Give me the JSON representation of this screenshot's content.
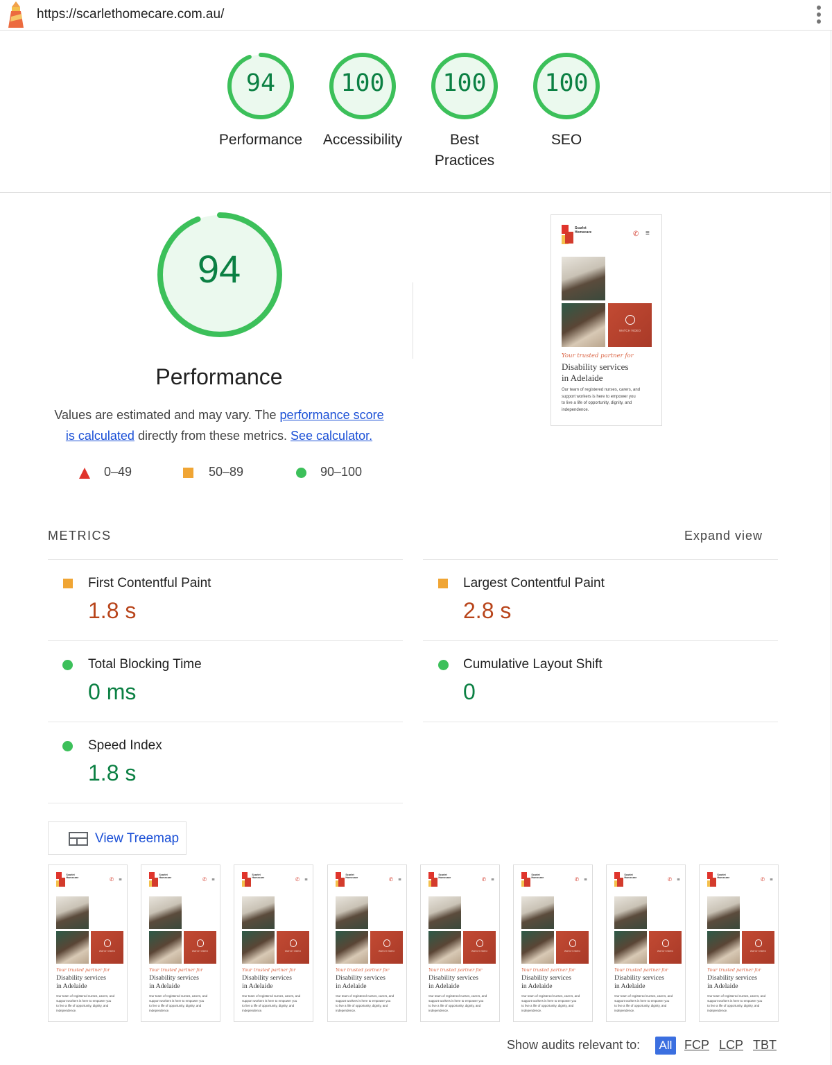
{
  "browser": {
    "url": "https://scarlethomecare.com.au/"
  },
  "colors": {
    "pass": "#3cc05a",
    "pass_text": "#0b8043",
    "average": "#f0a534",
    "average_text": "#b8441a",
    "fail": "#e0342c",
    "link": "#1a4fd6"
  },
  "categories": [
    {
      "score": "94",
      "score_fraction": 0.94,
      "label": "Performance"
    },
    {
      "score": "100",
      "score_fraction": 1.0,
      "label": "Accessibility"
    },
    {
      "score": "100",
      "score_fraction": 1.0,
      "label_line1": "Best",
      "label_line2": "Practices"
    },
    {
      "score": "100",
      "score_fraction": 1.0,
      "label": "SEO"
    }
  ],
  "performance": {
    "score": "94",
    "score_fraction": 0.94,
    "title": "Performance",
    "desc_part1": "Values are estimated and may vary. The ",
    "desc_link1_a": "performance score",
    "desc_link1_b": "is calculated",
    "desc_part2": " directly from these metrics. ",
    "desc_link2": "See calculator.",
    "legend": [
      {
        "range": "0–49",
        "shape": "triangle"
      },
      {
        "range": "50–89",
        "shape": "square"
      },
      {
        "range": "90–100",
        "shape": "circle"
      }
    ]
  },
  "screenshot": {
    "brand_line1": "Scarlet",
    "brand_line2": "Homecare",
    "watch_video": "WATCH VIDEO",
    "tagline": "Your trusted partner for",
    "heading_line1": "Disability services",
    "heading_line2": "in Adelaide",
    "body_line1": "Our team of registered nurses, carers, and",
    "body_line2": "support workers is here to empower you",
    "body_line3": "to live a life of opportunity, dignity, and",
    "body_line4": "independence."
  },
  "metrics": {
    "heading": "METRICS",
    "expand": "Expand view",
    "items": [
      {
        "label": "First Contentful Paint",
        "value": "1.8 s",
        "rating": "average"
      },
      {
        "label": "Largest Contentful Paint",
        "value": "2.8 s",
        "rating": "average"
      },
      {
        "label": "Total Blocking Time",
        "value": "0 ms",
        "rating": "pass"
      },
      {
        "label": "Cumulative Layout Shift",
        "value": "0",
        "rating": "pass"
      },
      {
        "label": "Speed Index",
        "value": "1.8 s",
        "rating": "pass"
      }
    ]
  },
  "treemap": {
    "label": "View Treemap"
  },
  "filmstrip_count": 8,
  "filter": {
    "label": "Show audits relevant to:",
    "options": [
      "All",
      "FCP",
      "LCP",
      "TBT"
    ],
    "selected": "All"
  }
}
